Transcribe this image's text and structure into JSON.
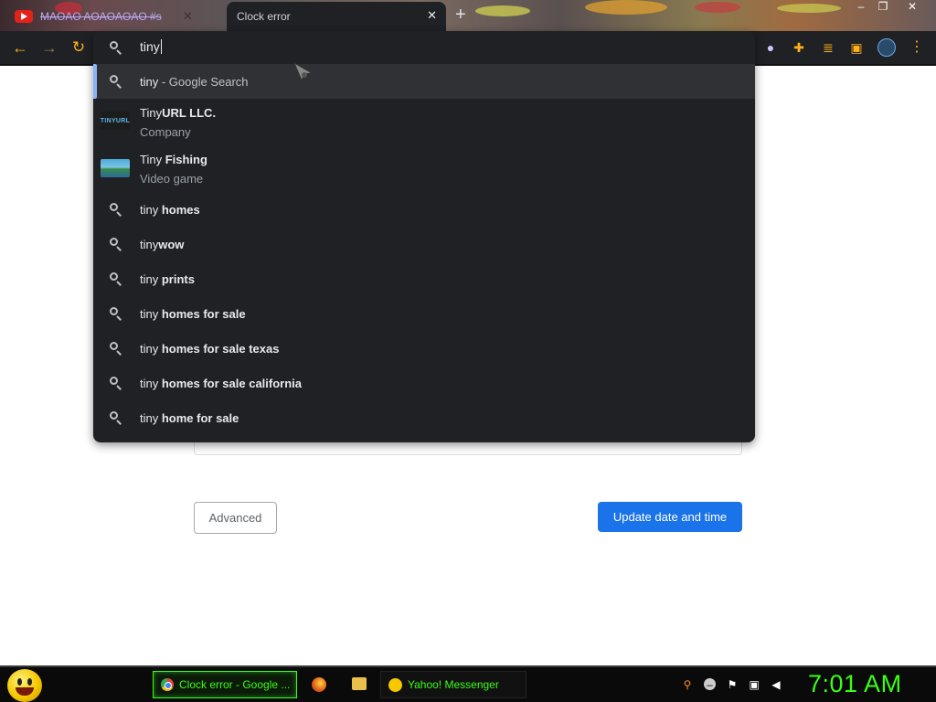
{
  "browser": {
    "tabs": [
      {
        "title": "MAOAO AOAOAOAO #s",
        "active": false
      },
      {
        "title": "Clock error",
        "active": true
      }
    ],
    "omnibox": {
      "query": "tiny"
    }
  },
  "suggestions": [
    {
      "type": "search",
      "prefix": "tiny",
      "bold": "",
      "suffix": " - Google Search"
    },
    {
      "type": "entity",
      "prefix": "Tiny",
      "bold": "URL LLC.",
      "sub": "Company",
      "image": "TINYURL"
    },
    {
      "type": "entity",
      "prefix": "Tiny ",
      "bold": "Fishing",
      "sub": "Video game"
    },
    {
      "type": "search",
      "prefix": "tiny ",
      "bold": "homes"
    },
    {
      "type": "search",
      "prefix": "tiny",
      "bold": "wow"
    },
    {
      "type": "search",
      "prefix": "tiny ",
      "bold": "prints"
    },
    {
      "type": "search",
      "prefix": "tiny ",
      "bold": "homes for sale"
    },
    {
      "type": "search",
      "prefix": "tiny ",
      "bold": "homes for sale texas"
    },
    {
      "type": "search",
      "prefix": "tiny ",
      "bold": "homes for sale california"
    },
    {
      "type": "search",
      "prefix": "tiny ",
      "bold": "home for sale"
    }
  ],
  "page": {
    "advanced_label": "Advanced",
    "update_label": "Update date and time"
  },
  "taskbar": {
    "chrome_task": "Clock error - Google ...",
    "yahoo_task": "Yahoo! Messenger",
    "clock": "7:01 AM"
  },
  "colors": {
    "accent": "#1a73e8",
    "omnibox_bg": "#202124",
    "taskbar_green": "#39ff14",
    "nav_orange": "#ffb01a"
  }
}
